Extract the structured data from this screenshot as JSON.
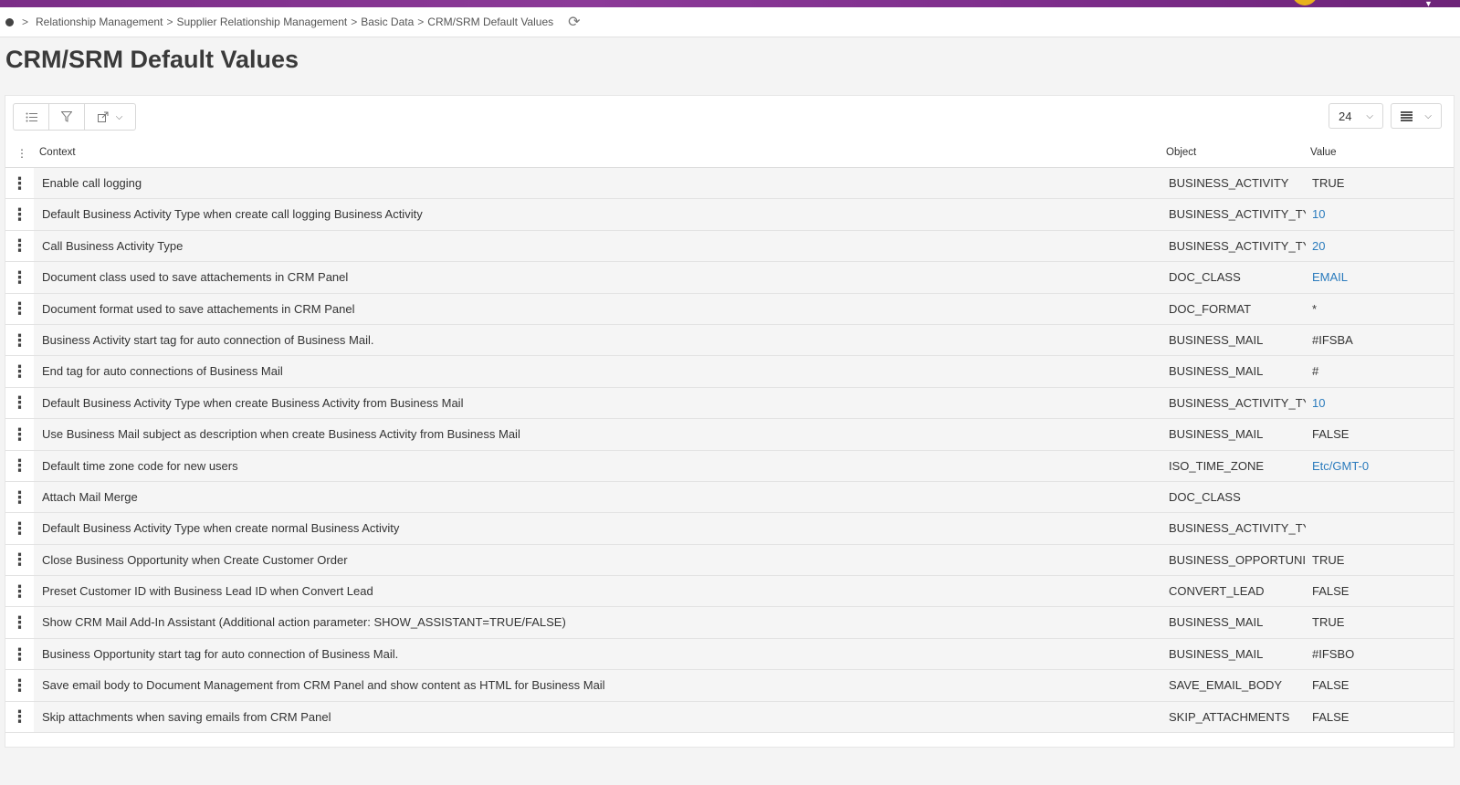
{
  "breadcrumb": {
    "items": [
      "Relationship Management",
      "Supplier Relationship Management",
      "Basic Data",
      "CRM/SRM Default Values"
    ]
  },
  "page": {
    "title": "CRM/SRM Default Values"
  },
  "toolbar": {
    "page_size": "24"
  },
  "table": {
    "headers": {
      "context": "Context",
      "object": "Object",
      "value": "Value"
    },
    "rows": [
      {
        "context": "Enable call logging",
        "object": "BUSINESS_ACTIVITY",
        "value": "TRUE",
        "link": false
      },
      {
        "context": "Default Business Activity Type when create call logging Business Activity",
        "object": "BUSINESS_ACTIVITY_TYP",
        "value": "10",
        "link": true
      },
      {
        "context": "Call Business Activity Type",
        "object": "BUSINESS_ACTIVITY_TYP",
        "value": "20",
        "link": true
      },
      {
        "context": "Document class used to save attachements in CRM Panel",
        "object": "DOC_CLASS",
        "value": "EMAIL",
        "link": true
      },
      {
        "context": "Document format used to save attachements in CRM Panel",
        "object": "DOC_FORMAT",
        "value": "*",
        "link": false
      },
      {
        "context": "Business Activity start tag for auto connection of Business Mail.",
        "object": "BUSINESS_MAIL",
        "value": "#IFSBA",
        "link": false
      },
      {
        "context": "End tag for auto connections of Business Mail",
        "object": "BUSINESS_MAIL",
        "value": "#",
        "link": false
      },
      {
        "context": "Default Business Activity Type when create Business Activity from Business Mail",
        "object": "BUSINESS_ACTIVITY_TYP",
        "value": "10",
        "link": true
      },
      {
        "context": "Use Business Mail subject as description when create Business Activity from Business Mail",
        "object": "BUSINESS_MAIL",
        "value": "FALSE",
        "link": false
      },
      {
        "context": "Default time zone code for new users",
        "object": "ISO_TIME_ZONE",
        "value": "Etc/GMT-0",
        "link": true
      },
      {
        "context": "Attach Mail Merge",
        "object": "DOC_CLASS",
        "value": "",
        "link": false
      },
      {
        "context": "Default Business Activity Type when create normal Business Activity",
        "object": "BUSINESS_ACTIVITY_TYP",
        "value": "",
        "link": false
      },
      {
        "context": "Close Business Opportunity when Create Customer Order",
        "object": "BUSINESS_OPPORTUNIT",
        "value": "TRUE",
        "link": false
      },
      {
        "context": "Preset Customer ID with Business Lead ID when Convert Lead",
        "object": "CONVERT_LEAD",
        "value": "FALSE",
        "link": false
      },
      {
        "context": "Show CRM Mail Add-In Assistant (Additional action parameter: SHOW_ASSISTANT=TRUE/FALSE)",
        "object": "BUSINESS_MAIL",
        "value": "TRUE",
        "link": false
      },
      {
        "context": "Business Opportunity start tag for auto connection of Business Mail.",
        "object": "BUSINESS_MAIL",
        "value": "#IFSBO",
        "link": false
      },
      {
        "context": "Save email body to Document Management from CRM Panel and show content as HTML for Business Mail",
        "object": "SAVE_EMAIL_BODY",
        "value": "FALSE",
        "link": false
      },
      {
        "context": "Skip attachments when saving emails from CRM Panel",
        "object": "SKIP_ATTACHMENTS",
        "value": "FALSE",
        "link": false
      }
    ]
  },
  "colors": {
    "accent_bar": "#7b2d87",
    "link": "#2a7bbd"
  },
  "icons": {
    "home": "home-dot-icon",
    "refresh": "refresh-icon",
    "list": "list-view-icon",
    "filter": "filter-icon",
    "export": "export-icon",
    "density": "density-icon",
    "row_menu": "kebab-icon"
  }
}
